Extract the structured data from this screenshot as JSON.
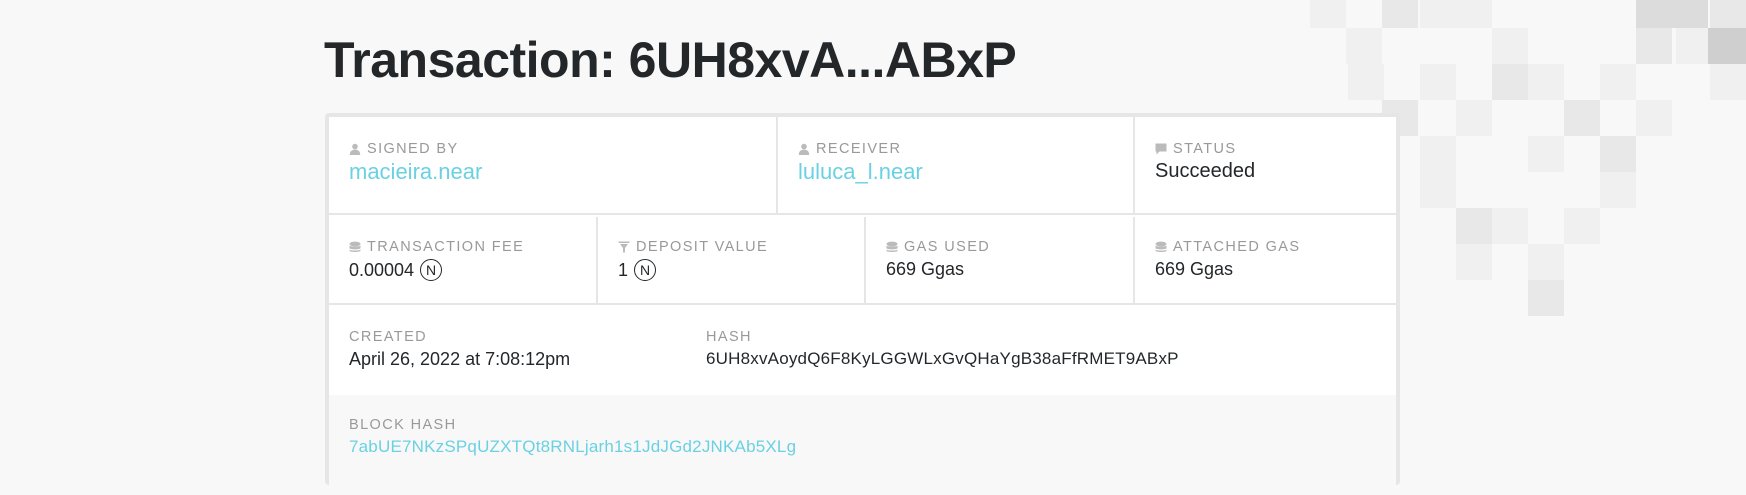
{
  "page": {
    "title": "Transaction: 6UH8xvA...ABxP"
  },
  "transaction": {
    "signed_by": {
      "label": "SIGNED BY",
      "icon": "user-icon",
      "value": "macieira.near"
    },
    "receiver": {
      "label": "RECEIVER",
      "icon": "user-icon",
      "value": "luluca_l.near"
    },
    "status": {
      "label": "STATUS",
      "icon": "chat-icon",
      "value": "Succeeded"
    },
    "transaction_fee": {
      "label": "TRANSACTION FEE",
      "icon": "coins-icon",
      "value": "0.00004",
      "unit_icon": "near-token-icon",
      "unit_symbol": "N"
    },
    "deposit_value": {
      "label": "DEPOSIT VALUE",
      "icon": "filter-icon",
      "value": "1",
      "unit_icon": "near-token-icon",
      "unit_symbol": "N"
    },
    "gas_used": {
      "label": "GAS USED",
      "icon": "coins-icon",
      "value": "669 Ggas"
    },
    "attached_gas": {
      "label": "ATTACHED GAS",
      "icon": "coins-icon",
      "value": "669 Ggas"
    },
    "created": {
      "label": "CREATED",
      "value": "April 26, 2022 at 7:08:12pm"
    },
    "hash": {
      "label": "HASH",
      "value": "6UH8xvAoydQ6F8KyLGGWLxGvQHaYgB38aFfRMET9ABxP"
    },
    "block_hash": {
      "label": "BLOCK HASH",
      "value": "7abUE7NKzSPqUZXTQt8RNLjarh1s1JdJGd2JNKAb5XLg"
    }
  },
  "colors": {
    "link": "#6ad1e3",
    "label": "#999999",
    "text": "#24272a",
    "border": "#e6e6e6",
    "background": "#f8f8f8"
  }
}
